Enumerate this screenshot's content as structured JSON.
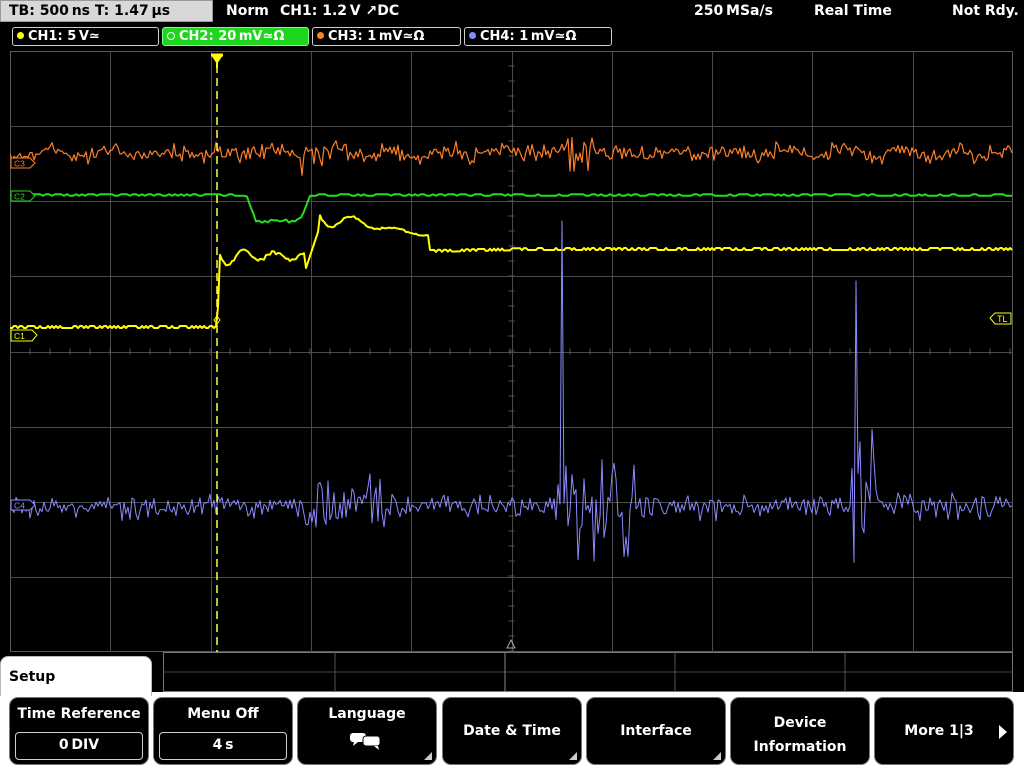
{
  "status": {
    "timebase": "TB: 500 ns   T: 1.47 µs",
    "mode": "Norm",
    "trigger_info": "CH1: 1.2 V ↗DC",
    "sample_rate": "250 MSa/s",
    "acq_mode": "Real Time",
    "ready_state": "Not Rdy."
  },
  "channels": [
    {
      "label": "CH1: 5 V≃",
      "color": "#ffff00"
    },
    {
      "label": "CH2: 20 mV≃Ω",
      "color": "#22dd22"
    },
    {
      "label": "CH3: 1 mV≃Ω",
      "color": "#ff7f27"
    },
    {
      "label": "CH4: 1 mV≃Ω",
      "color": "#8a8aff"
    }
  ],
  "markers": {
    "ch3": "C3",
    "ch2": "C2",
    "ch1": "C1",
    "ch4": "C4",
    "trigger_level": "TL"
  },
  "menu": {
    "title": "Setup",
    "softkeys": [
      {
        "label": "Time Reference",
        "value": "0 DIV"
      },
      {
        "label": "Menu Off",
        "value": "4 s"
      },
      {
        "label": "Language"
      },
      {
        "label": "Date & Time"
      },
      {
        "label": "Interface"
      },
      {
        "label": "Device",
        "label2": "Information"
      },
      {
        "label": "More 1|3"
      }
    ]
  },
  "colors": {
    "ch1": "#ffff00",
    "ch2": "#22dd22",
    "ch3": "#ff7f27",
    "ch4": "#8a8aff",
    "grid": "#4a4a4a",
    "trigger_cursor": "#ffff40"
  },
  "icons": {
    "language": "speech-bubbles-icon",
    "more": "arrow-right-icon",
    "trigger_position": "trigger-position-icon"
  }
}
